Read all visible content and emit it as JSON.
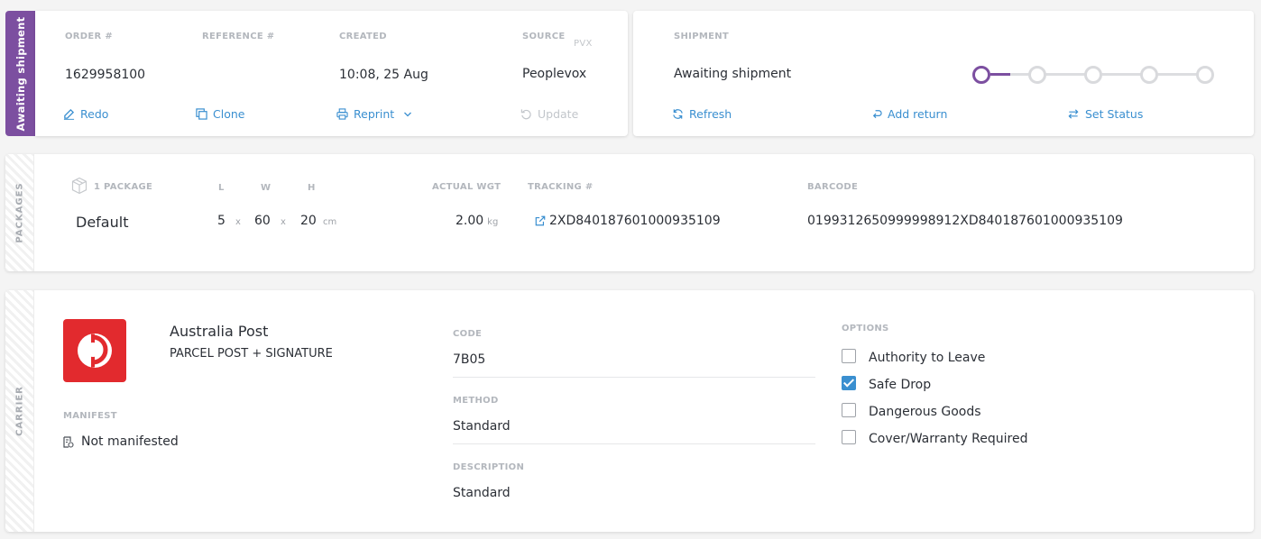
{
  "status": {
    "label": "Awaiting shipment",
    "color": "#7c4fa0"
  },
  "order": {
    "order_label": "ORDER #",
    "order_value": "1629958100",
    "reference_label": "REFERENCE #",
    "reference_value": "",
    "created_label": "CREATED",
    "created_value": "10:08, 25 Aug",
    "source_label": "SOURCE",
    "source_tag": "PVX",
    "source_value": "Peoplevox",
    "actions": {
      "redo": "Redo",
      "clone": "Clone",
      "reprint": "Reprint",
      "update": "Update"
    }
  },
  "shipment": {
    "label": "SHIPMENT",
    "status_value": "Awaiting shipment",
    "progress": {
      "steps_total": 5,
      "current_step": 1
    },
    "actions": {
      "refresh": "Refresh",
      "add_return": "Add return",
      "set_status": "Set Status"
    }
  },
  "packages": {
    "side_label": "PACKAGES",
    "count_label": "1 PACKAGE",
    "l_label": "L",
    "w_label": "W",
    "h_label": "H",
    "weight_label": "ACTUAL WGT",
    "tracking_label": "TRACKING #",
    "barcode_label": "BARCODE",
    "rows": [
      {
        "name": "Default",
        "l": "5",
        "w": "60",
        "h": "20",
        "dim_sep": "x",
        "dim_unit": "cm",
        "weight": "2.00",
        "weight_unit": "kg",
        "tracking": "2XD840187601000935109",
        "barcode": "019931265099999891 2XD840187601000935109"
      }
    ]
  },
  "carrier": {
    "side_label": "CARRIER",
    "name": "Australia Post",
    "service": "PARCEL POST + SIGNATURE",
    "brand_color": "#e22a2e",
    "manifest_label": "MANIFEST",
    "manifest_value": "Not manifested",
    "code_label": "CODE",
    "code_value": "7B05",
    "method_label": "METHOD",
    "method_value": "Standard",
    "description_label": "DESCRIPTION",
    "description_value": "Standard",
    "options_label": "OPTIONS",
    "options": [
      {
        "label": "Authority to Leave",
        "checked": false
      },
      {
        "label": "Safe Drop",
        "checked": true
      },
      {
        "label": "Dangerous Goods",
        "checked": false
      },
      {
        "label": "Cover/Warranty Required",
        "checked": false
      }
    ]
  }
}
